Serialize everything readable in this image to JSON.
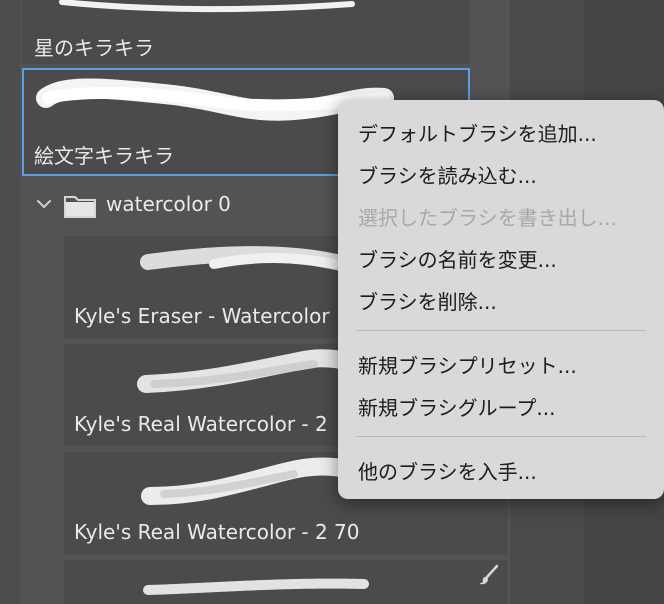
{
  "brushes": {
    "top_label": "星のキラキラ",
    "selected_label": "絵文字キラキラ"
  },
  "group": {
    "name": "watercolor 0"
  },
  "sub_brushes": [
    {
      "label": "Kyle's Eraser - Watercolor"
    },
    {
      "label": "Kyle's Real Watercolor - 2"
    },
    {
      "label": "Kyle's Real Watercolor - 2 70"
    }
  ],
  "context_menu": {
    "items": [
      {
        "label": "デフォルトブラシを追加...",
        "enabled": true
      },
      {
        "label": "ブラシを読み込む...",
        "enabled": true
      },
      {
        "label": "選択したブラシを書き出し...",
        "enabled": false
      },
      {
        "label": "ブラシの名前を変更...",
        "enabled": true
      },
      {
        "label": "ブラシを削除...",
        "enabled": true
      },
      {
        "label": "新規ブラシプリセット...",
        "enabled": true
      },
      {
        "label": "新規ブラシグループ...",
        "enabled": true
      },
      {
        "label": "他のブラシを入手...",
        "enabled": true
      }
    ]
  },
  "colors": {
    "panel_bg": "#535353",
    "item_bg": "#4b4b4b",
    "selection": "#5b9ee6",
    "menu_bg": "#d9d9d9",
    "menu_text": "#1c1c1c",
    "menu_disabled": "#a8a8a8"
  }
}
